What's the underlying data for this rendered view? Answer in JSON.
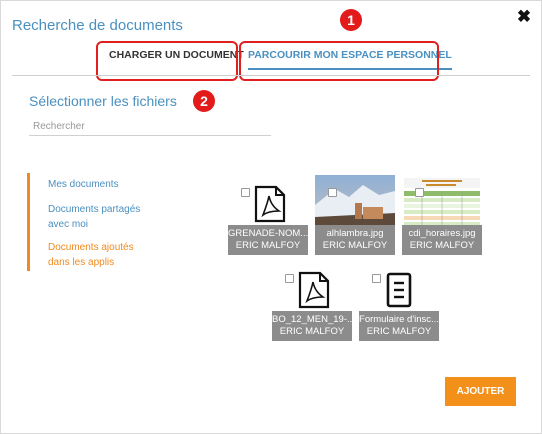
{
  "dialog": {
    "title": "Recherche de documents",
    "close_icon": "close-icon"
  },
  "tabs": [
    {
      "label": "CHARGER UN DOCUMENT",
      "active": false
    },
    {
      "label": "PARCOURIR MON ESPACE PERSONNEL",
      "active": true
    }
  ],
  "annotations": {
    "marker_1": "1",
    "marker_2": "2",
    "color": "#e21a1a"
  },
  "section_title": "Sélectionner les fichiers",
  "search": {
    "placeholder": "Rechercher",
    "value": ""
  },
  "sidebar": {
    "accent_color": "#f08a1e",
    "items": [
      {
        "label": "Mes documents"
      },
      {
        "label": "Documents partagés avec moi"
      },
      {
        "label": "Documents ajoutés dans les applis",
        "active": true
      }
    ]
  },
  "files": [
    {
      "name": "GRENADE-NOM...",
      "owner": "ERIC MALFOY",
      "icon": "pdf-file-icon"
    },
    {
      "name": "alhlambra.jpg",
      "owner": "ERIC MALFOY",
      "icon": "image-thumbnail"
    },
    {
      "name": "cdi_horaires.jpg",
      "owner": "ERIC MALFOY",
      "icon": "image-thumbnail"
    },
    {
      "name": "BO_12_MEN_19-...",
      "owner": "ERIC MALFOY",
      "icon": "pdf-file-icon"
    },
    {
      "name": "Formulaire d'insc...",
      "owner": "ERIC MALFOY",
      "icon": "text-document-icon"
    }
  ],
  "add_button": {
    "label": "AJOUTER",
    "color": "#f39019"
  }
}
